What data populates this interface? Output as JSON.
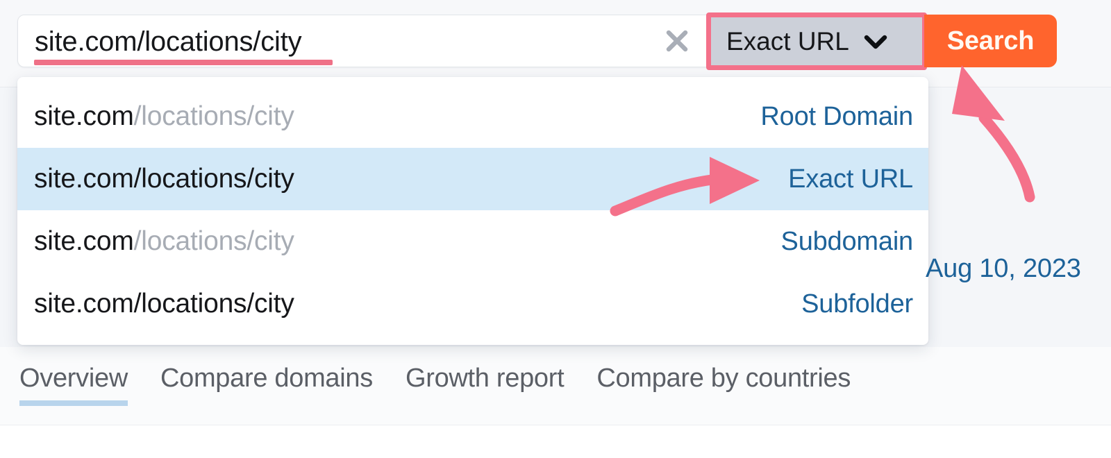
{
  "search": {
    "input_value": "site.com/locations/city",
    "clear_icon": "close-icon",
    "mode_label": "Exact URL",
    "mode_chevron_icon": "chevron-down-icon",
    "search_button_label": "Search",
    "highlight_color": "#f4718a",
    "underline_color": "#ef7187",
    "button_color": "#ff642d"
  },
  "suggestions": {
    "items": [
      {
        "url_bold": "site.com",
        "url_dim": "/locations/city",
        "url_full": "site.com/locations/city",
        "type": "Root Domain",
        "active": false
      },
      {
        "url_bold": "site.com/locations/city",
        "url_dim": "",
        "url_full": "site.com/locations/city",
        "type": "Exact URL",
        "active": true
      },
      {
        "url_bold": "site.com",
        "url_dim": "/locations/city",
        "url_full": "site.com/locations/city",
        "type": "Subdomain",
        "active": false
      },
      {
        "url_bold": "site.com/locations/city",
        "url_dim": "",
        "url_full": "site.com/locations/city",
        "type": "Subfolder",
        "active": false
      }
    ],
    "active_row_color": "#d3e9f8",
    "type_link_color": "#1d6299"
  },
  "annotations": {
    "arrow_color": "#f4718a",
    "arrow_to_exact_url": "curved-arrow-right-icon",
    "arrow_to_search_button": "curved-arrow-up-icon"
  },
  "page": {
    "date_label": "Aug 10, 2023"
  },
  "tabs": {
    "items": [
      {
        "label": "Overview",
        "active": true
      },
      {
        "label": "Compare domains",
        "active": false
      },
      {
        "label": "Growth report",
        "active": false
      },
      {
        "label": "Compare by countries",
        "active": false
      }
    ],
    "active_underline_color": "#b8d4ec"
  }
}
